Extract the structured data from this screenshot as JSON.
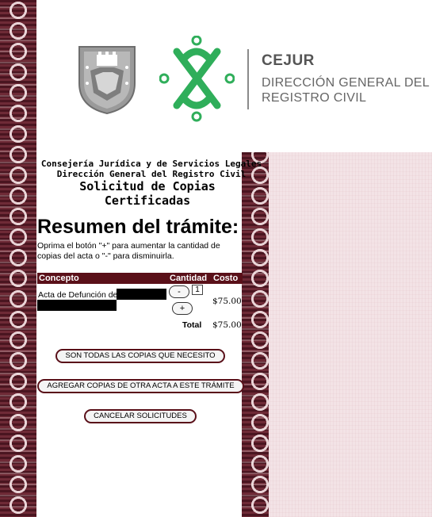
{
  "header": {
    "cejur": "CEJUR",
    "direccion_line1": "DIRECCIÓN GENERAL DEL",
    "direccion_line2": "REGISTRO CIVIL",
    "icons": [
      "coat-of-arms-icon",
      "cdmx-logo-icon"
    ],
    "colors": {
      "logo_green": "#2fae5a",
      "text_gray": "#666666"
    }
  },
  "page": {
    "org_line1": "Consejería Jurídica y de Servicios Legales",
    "org_line2": "Dirección General del Registro Civil",
    "title_line1": "Solicitud de Copias",
    "title_line2": "Certificadas",
    "summary_title": "Resumen del trámite:",
    "instructions": "Oprima el botón \"+\" para aumentar la cantidad de copias del acta o \"-\" para disminuirla."
  },
  "table": {
    "headers": {
      "concepto": "Concepto",
      "cantidad": "Cantidad",
      "costo": "Costo"
    },
    "rows": [
      {
        "concepto": "Acta de Defunción de",
        "cantidad": "1",
        "costo": "$75.00"
      }
    ],
    "total_label": "Total",
    "total_value": "$75.00",
    "minus_label": "-",
    "plus_label": "+",
    "header_color": "#5a1019"
  },
  "actions": {
    "done": "SON TODAS LAS COPIAS QUE NECESITO",
    "add_other": "AGREGAR COPIAS DE OTRA ACTA A ESTE TRÁMITE",
    "cancel": "CANCELAR SOLICITUDES"
  }
}
